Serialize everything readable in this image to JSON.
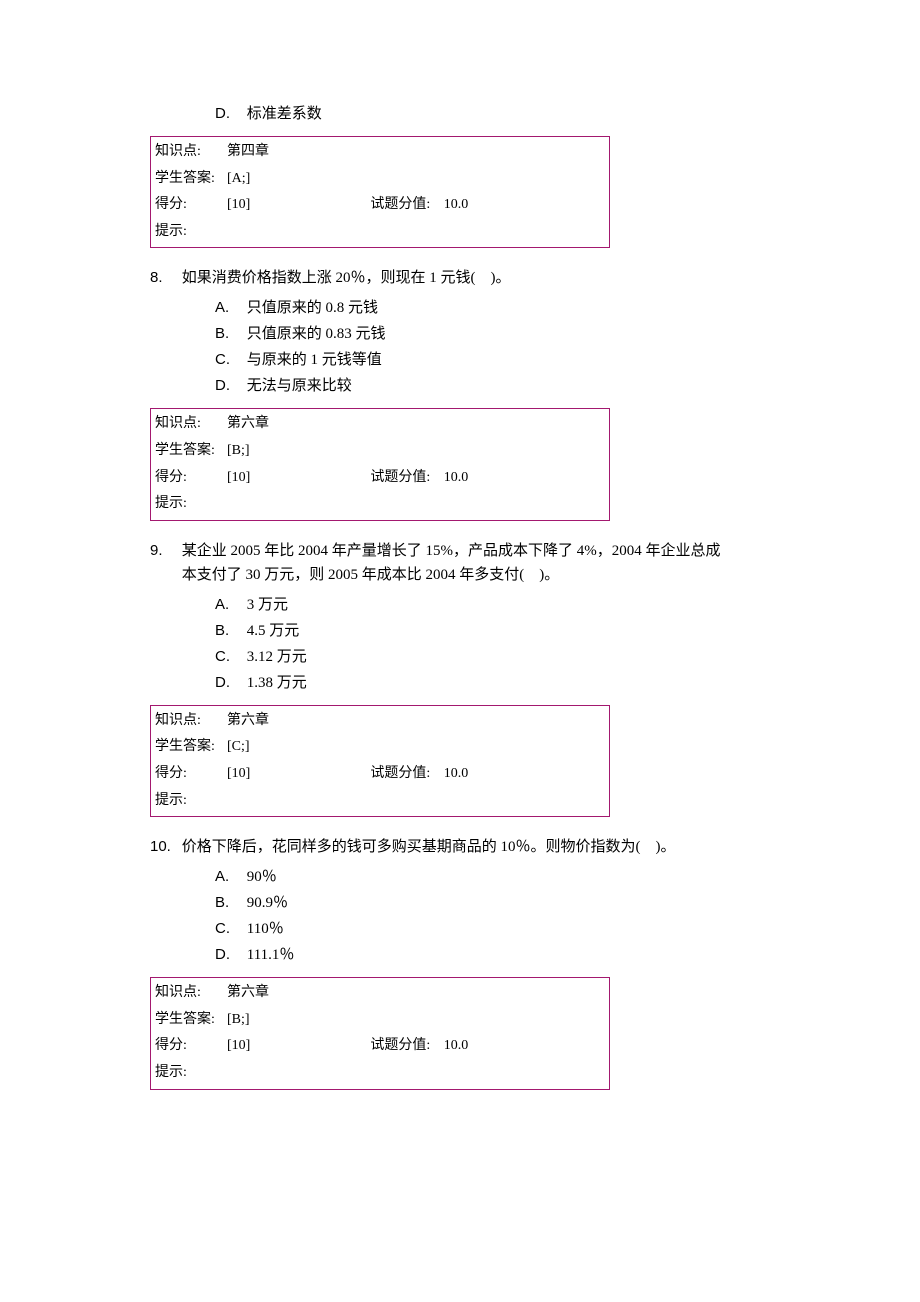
{
  "labels": {
    "knowledge": "知识点:",
    "student_ans": "学生答案:",
    "score": "得分:",
    "item_score": "试题分值:",
    "hint": "提示:"
  },
  "opt_letters": {
    "A": "A.",
    "B": "B.",
    "C": "C.",
    "D": "D."
  },
  "frag": {
    "opt_d": "标准差系数",
    "box": {
      "knowledge": "第四章",
      "ans": "[A;]",
      "score": "[10]",
      "item_score": "10.0"
    }
  },
  "q8": {
    "num": "8.",
    "stem": " 如果消费价格指数上涨 20％，则现在 1 元钱( )。",
    "A": "只值原来的 0.8 元钱",
    "B": "只值原来的 0.83 元钱",
    "C": "与原来的 1 元钱等值",
    "D": "无法与原来比较",
    "box": {
      "knowledge": "第六章",
      "ans": "[B;]",
      "score": "[10]",
      "item_score": "10.0"
    }
  },
  "q9": {
    "num": "9.",
    "stem": "某企业 2005 年比 2004 年产量增长了 15%，产品成本下降了 4%，2004 年企业总成本支付了 30 万元，则 2005 年成本比 2004 年多支付( )。",
    "A": "3 万元",
    "B": "4.5 万元",
    "C": "3.12 万元",
    "D": "1.38 万元",
    "box": {
      "knowledge": "第六章",
      "ans": "[C;]",
      "score": "[10]",
      "item_score": "10.0"
    }
  },
  "q10": {
    "num": "10.",
    "stem": "价格下降后，花同样多的钱可多购买基期商品的 10％。则物价指数为( )。",
    "A": "90％",
    "B": "90.9％",
    "C": "110％",
    "D": "111.1％",
    "box": {
      "knowledge": "第六章",
      "ans": "[B;]",
      "score": "[10]",
      "item_score": "10.0"
    }
  }
}
